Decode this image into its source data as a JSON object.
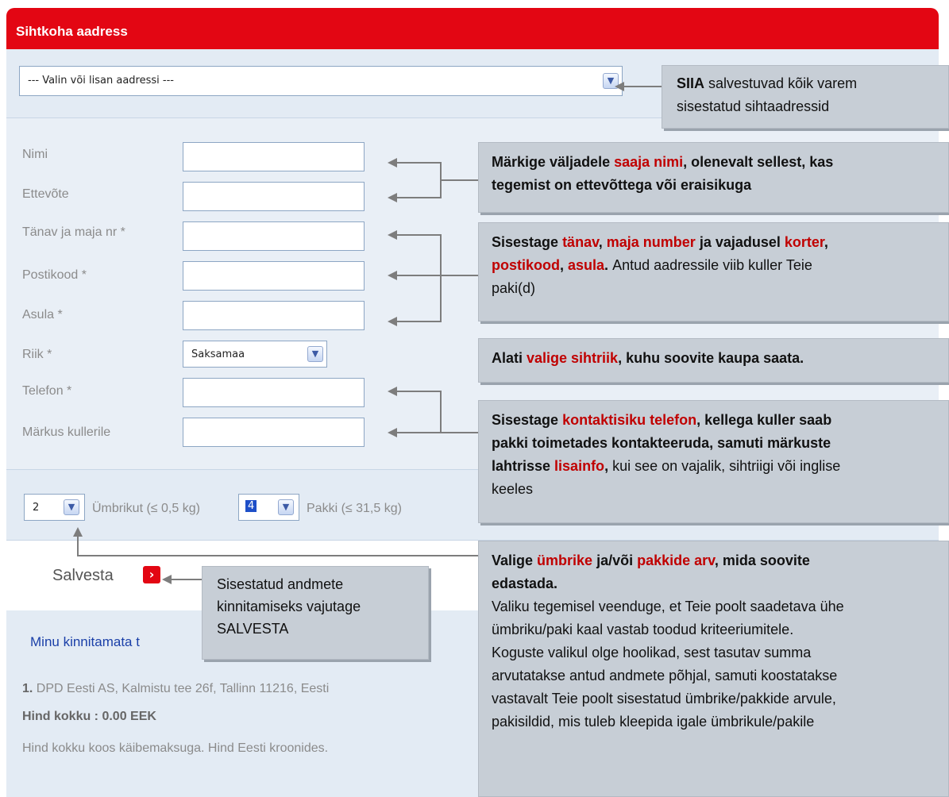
{
  "header": {
    "title": "Sihtkoha aadress"
  },
  "address_select": {
    "value": "--- Valin või lisan aadressi ---"
  },
  "fields": {
    "nimi": "Nimi",
    "ettevote": "Ettevõte",
    "tanav": "Tänav ja maja nr *",
    "postikood": "Postikood *",
    "asula": "Asula *",
    "riik": "Riik *",
    "telefon": "Telefon *",
    "markus": "Märkus kullerile"
  },
  "country_select": {
    "value": "Saksamaa"
  },
  "package_row": {
    "envelope_count": "2",
    "envelope_label": "Ümbrikut (≤ 0,5 kg)",
    "package_count": "4",
    "package_label": "Pakki (≤ 31,5 kg)"
  },
  "save": {
    "label": "Salvesta",
    "icon": "chevron-right-icon"
  },
  "summary": {
    "link_partial": "Minu kinnitamata t",
    "item_number": "1.",
    "item_text": " DPD Eesti AS, Kalmistu tee 26f, Tallinn 11216, Eesti",
    "total": "Hind kokku : 0.00 EEK",
    "note": "Hind kokku koos käibemaksuga. Hind Eesti kroonides."
  },
  "callouts": {
    "siia": {
      "bold": "SIIA",
      "text1": "  salvestuvad kõik varem",
      "text2": "sisestatud sihtaadressid"
    },
    "name": {
      "p1": "Märkige väljadele ",
      "r1": "saaja nimi",
      "p2": ", olenevalt sellest, kas",
      "line2": "tegemist on ettevõttega või eraisikuga"
    },
    "address": {
      "p1": "Sisestage ",
      "r1": "tänav",
      "p2": ", ",
      "r2": "maja number",
      "p3": " ja vajadusel ",
      "r3": "korter",
      "p4": ",",
      "r4": "postikood",
      "p5": ", ",
      "r5": "asula",
      "p6": ". ",
      "n1": "Antud aadressile viib kuller Teie",
      "n2": "paki(d)"
    },
    "country": {
      "p1": "Alati ",
      "r1": "valige sihtriik",
      "p2": ", kuhu soovite kaupa saata."
    },
    "phone": {
      "p1": "Sisestage ",
      "r1": "kontaktisiku telefon",
      "p2": ", kellega kuller saab",
      "line2": "pakki toimetades kontakteeruda, samuti märkuste",
      "p3": "lahtrisse ",
      "r2": "lisainfo",
      "p4": ", ",
      "n1": "kui see on vajalik, sihtriigi või inglise",
      "n2": "keeles"
    },
    "packages": {
      "p1": "Valige ",
      "r1": "ümbrike",
      "p2": " ja/või ",
      "r2": "pakkide arv",
      "p3": ", mida soovite",
      "line2": "edastada.",
      "body": [
        "Valiku tegemisel veenduge, et Teie poolt saadetava ühe",
        "ümbriku/paki kaal vastab toodud kriteeriumitele.",
        "Koguste valikul olge hoolikad, sest tasutav summa",
        "arvutatakse antud andmete põhjal, samuti koostatakse",
        "vastavalt Teie poolt sisestatud ümbrike/pakkide arvule,",
        "pakisildid, mis tuleb kleepida igale ümbrikule/pakile"
      ]
    },
    "save": {
      "line1": "Sisestatud andmete",
      "line2": "kinnitamiseks vajutage",
      "line3": "SALVESTA"
    }
  }
}
